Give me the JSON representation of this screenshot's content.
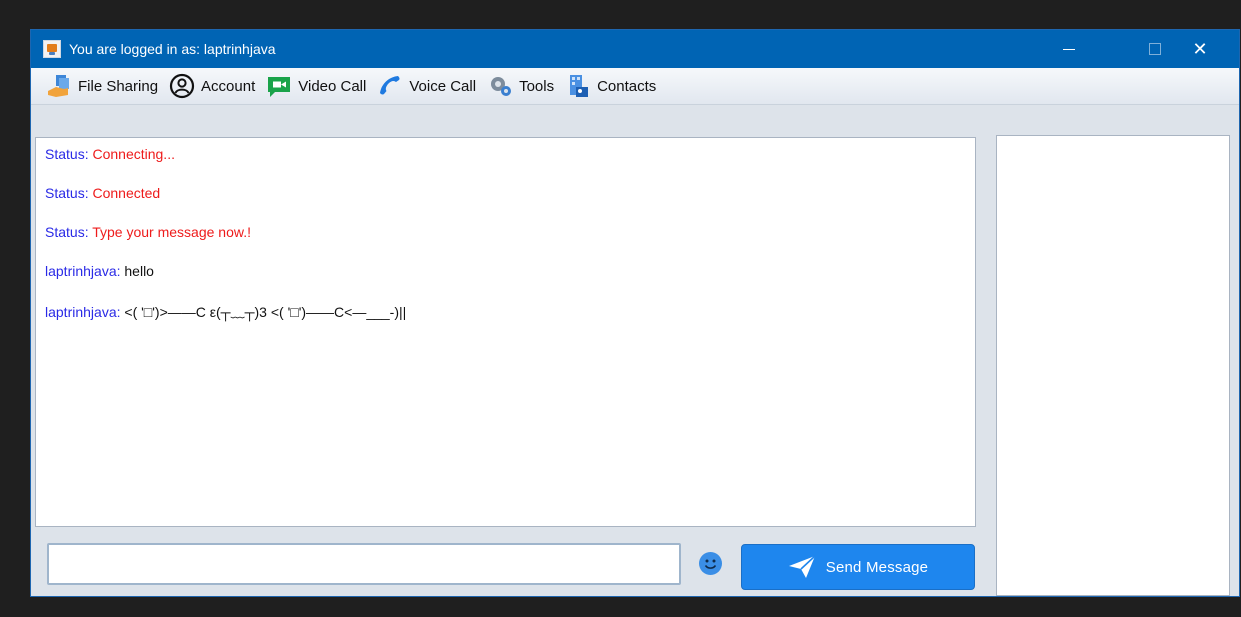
{
  "window": {
    "title": "You are logged in as: laptrinhjava",
    "controls": {
      "minimize": "minimize",
      "maximize": "maximize",
      "close": "✕"
    }
  },
  "menu": [
    {
      "label": "File Sharing",
      "icon": "file-sharing-icon"
    },
    {
      "label": "Account",
      "icon": "account-icon"
    },
    {
      "label": "Video Call",
      "icon": "video-call-icon"
    },
    {
      "label": "Voice Call",
      "icon": "phone-icon"
    },
    {
      "label": "Tools",
      "icon": "tools-icon"
    },
    {
      "label": "Contacts",
      "icon": "contacts-icon"
    }
  ],
  "chat": {
    "lines": [
      {
        "label": "Status:",
        "text": "Connecting...",
        "type": "status"
      },
      {
        "label": "Status:",
        "text": "Connected",
        "type": "status"
      },
      {
        "label": "Status:",
        "text": "Type your message now.!",
        "type": "status"
      },
      {
        "label": "laptrinhjava:",
        "text": "hello",
        "type": "message"
      },
      {
        "label": "laptrinhjava:",
        "text": " <( '□')>——C ε(┬﹏┬)3  <( '□')——C<—___-)||",
        "type": "message"
      }
    ]
  },
  "input": {
    "value": "",
    "placeholder": ""
  },
  "send_button": {
    "label": "Send Message"
  },
  "colors": {
    "titlebar": "#0064b4",
    "label": "#2a2ae6",
    "status": "#ee1b1b",
    "send_button": "#1e86ee"
  }
}
